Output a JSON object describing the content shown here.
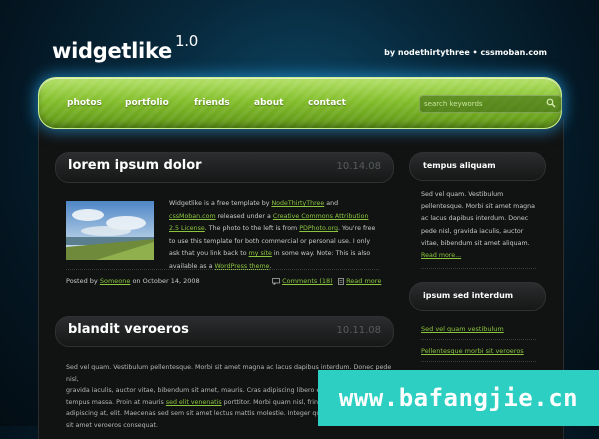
{
  "header": {
    "logo": "widgetlike",
    "logo_version": "1.0",
    "byline": "by nodethirtythree • cssmoban.com"
  },
  "nav": {
    "items": [
      "photos",
      "portfolio",
      "friends",
      "about",
      "contact"
    ],
    "search_placeholder": "search keywords",
    "search_icon": "magnifier-icon"
  },
  "posts": [
    {
      "title": "lorem ipsum dolor",
      "date": "10.14.08",
      "body": [
        {
          "t": "Widgetlike is a free template by "
        },
        {
          "t": "NodeThirtyThree",
          "link": true
        },
        {
          "t": " and "
        },
        {
          "t": "cssMoban.com",
          "link": true
        },
        {
          "t": " released under a "
        },
        {
          "t": "Creative Commons Attribution 2.5 License",
          "link": true
        },
        {
          "t": ". The photo to the left is from "
        },
        {
          "t": "PDPhoto.org",
          "link": true
        },
        {
          "t": ". You're free to use this template for both commercial or personal use. I only ask that you link back to "
        },
        {
          "t": "my site",
          "link": true
        },
        {
          "t": " in some way. Note: This is also available as a "
        },
        {
          "t": "WordPress theme",
          "link": true
        },
        {
          "t": "."
        }
      ],
      "posted_prefix": "Posted by",
      "author": "Someone",
      "posted_on": "on October 14, 2008",
      "comments": "Comments (18)",
      "read_more": "Read more"
    },
    {
      "title": "blandit veroeros",
      "date": "10.11.08",
      "body_lines": [
        "Sed vel quam. Vestibulum pellentesque. Morbi sit amet magna ac lacus dapibus interdum. Donec pede nisl,",
        "gravida iaculis, auctor vitae, bibendum sit amet, mauris. Cras adipiscing libero et risus. Donec rutrum",
        "tempus massa. Proin at mauris [sed elit venenatis] porttitor. Morbi quam nisl, fringilla quis, sagittis",
        "adipiscing at, elit. Maecenas sed sem sit amet lectus mattis molestie. Integer quis eros ut erat posuere",
        "sit amet veroeros consequat."
      ],
      "body_link": "sed elit venenatis"
    }
  ],
  "sidebar": {
    "box1": {
      "title": "tempus aliquam",
      "text": "Sed vel quam. Vestibulum pellentesque. Morbi sit amet magna ac lacus dapibus interdum. Donec pede nisl, gravida iaculis, auctor vitae, bibendum sit amet aliquam.",
      "more": "Read more..."
    },
    "box2": {
      "title": "ipsum sed interdum",
      "links": [
        "Sed vel quam vestibulum",
        "Pellentesque morbi sit veroeros"
      ]
    }
  },
  "watermark": "www.bafangjie.cn",
  "colors": {
    "accent_green": "#8cc63f",
    "nav_green": "#84bf2d",
    "watermark_bg": "#2ccfc1"
  }
}
